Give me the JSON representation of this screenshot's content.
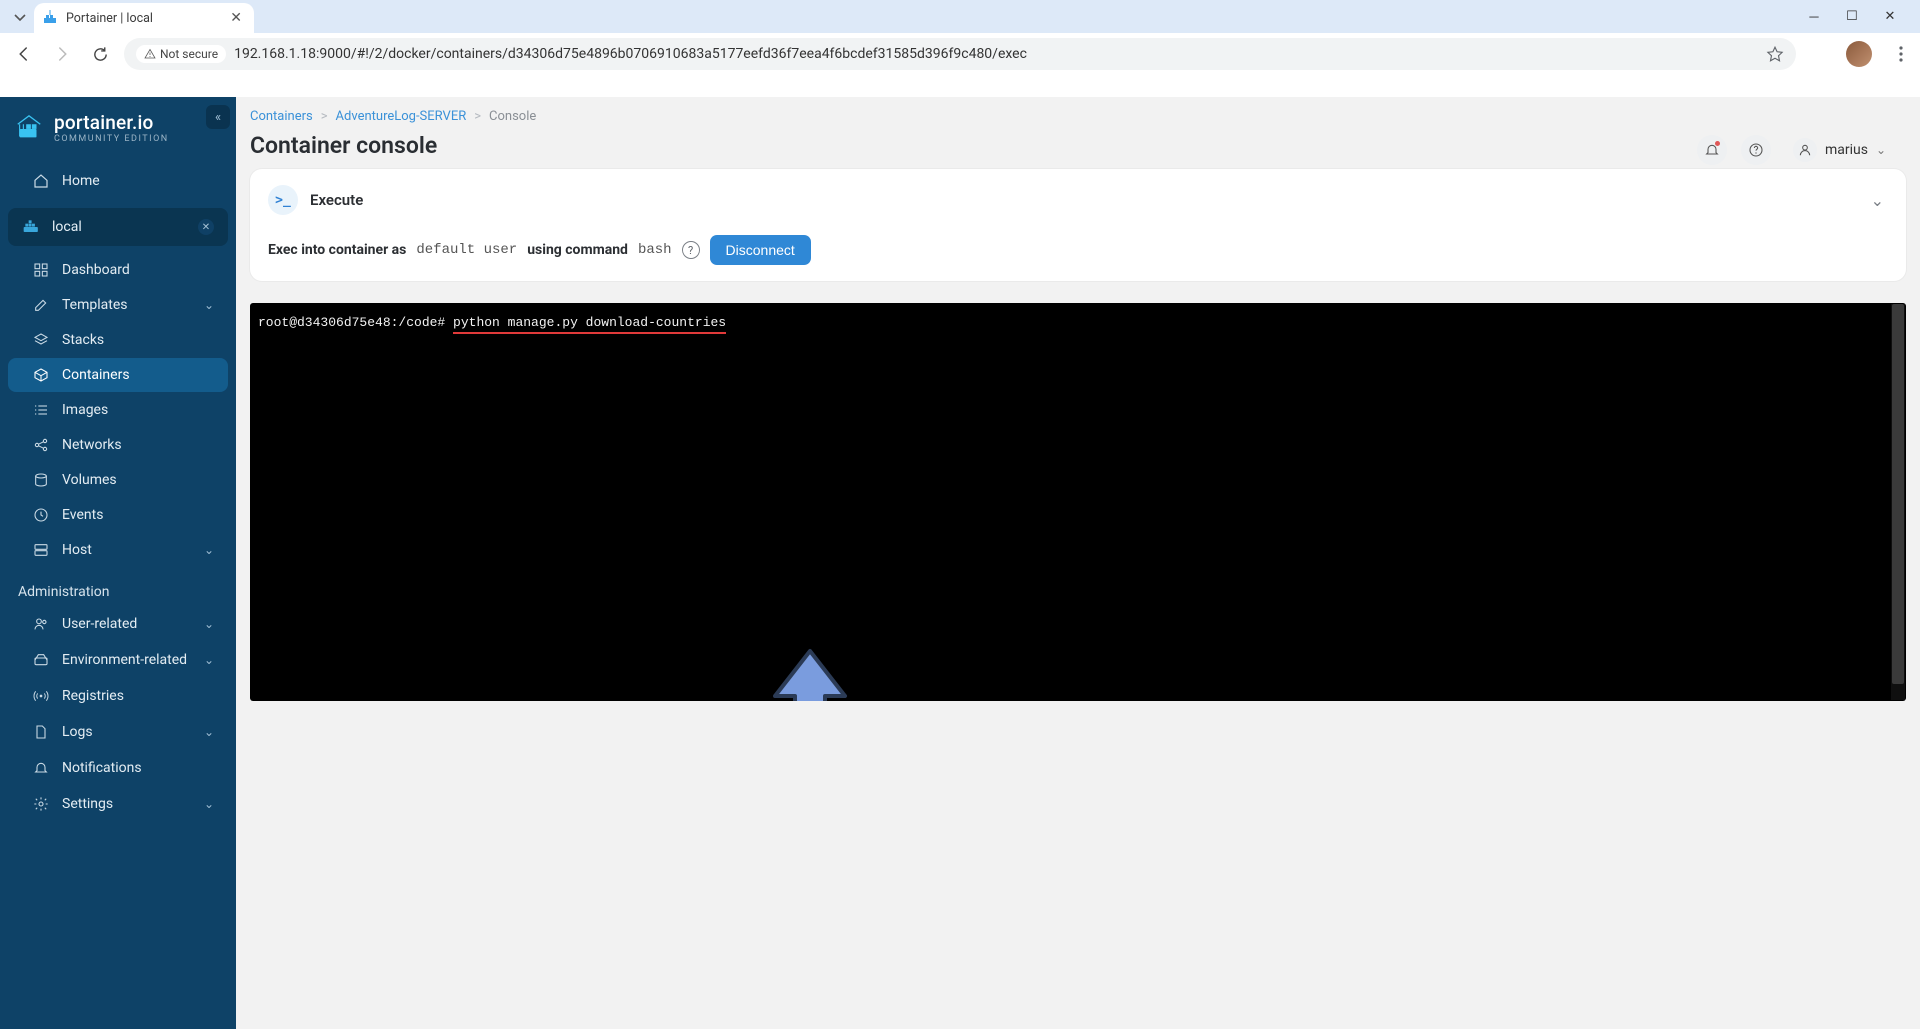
{
  "browser": {
    "tab_title": "Portainer | local",
    "address_badge": "Not secure",
    "url": "192.168.1.18:9000/#!/2/docker/containers/d34306d75e4896b0706910683a5177eefd36f7eea4f6bcdef31585d396f9c480/exec"
  },
  "portainer": {
    "brand_name": "portainer.io",
    "brand_sub": "COMMUNITY EDITION",
    "home_label": "Home",
    "env_label": "local",
    "menu": {
      "dashboard": "Dashboard",
      "templates": "Templates",
      "stacks": "Stacks",
      "containers": "Containers",
      "images": "Images",
      "networks": "Networks",
      "volumes": "Volumes",
      "events": "Events",
      "host": "Host"
    },
    "admin_section": "Administration",
    "admin": {
      "user_related": "User-related",
      "env_related": "Environment-related",
      "registries": "Registries",
      "logs": "Logs",
      "notifications": "Notifications",
      "settings": "Settings"
    }
  },
  "breadcrumb": {
    "containers": "Containers",
    "container_name": "AdventureLog-SERVER",
    "console": "Console"
  },
  "page": {
    "title": "Container console",
    "user": "marius",
    "execute_label": "Execute",
    "exec_prefix": "Exec into container as",
    "exec_user": "default user",
    "exec_mid": "using command",
    "exec_cmd": "bash",
    "disconnect": "Disconnect"
  },
  "terminal": {
    "prompt": "root@d34306d75e48:/code#",
    "command": "python manage.py download-countries"
  }
}
